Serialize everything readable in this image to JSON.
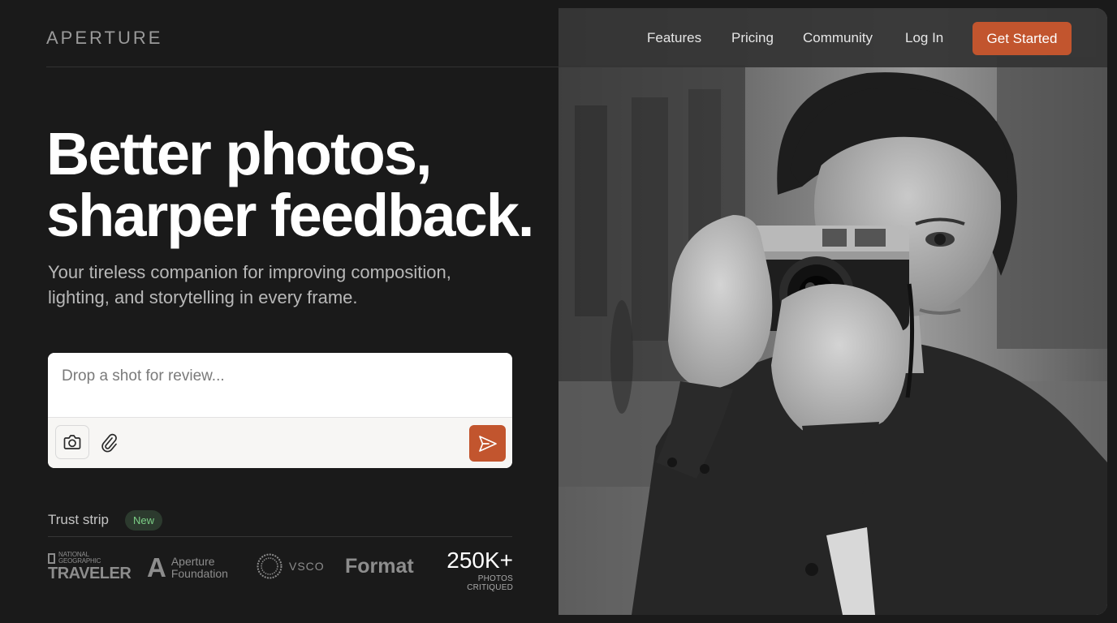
{
  "brand": {
    "name": "APERTURE"
  },
  "nav": {
    "links": [
      "Features",
      "Pricing",
      "Community",
      "Log In"
    ],
    "cta": "Get Started"
  },
  "hero": {
    "headline_line1": "Better photos,",
    "headline_line2": "sharper feedback.",
    "subtitle": "Your tireless companion for improving composition, lighting, and storytelling in every frame."
  },
  "composer": {
    "placeholder": "Drop a shot for review...",
    "icons": {
      "camera": "camera-icon",
      "attach": "paperclip-icon",
      "send": "send-icon"
    }
  },
  "trust": {
    "label": "Trust strip",
    "badge": "New",
    "logos": {
      "natgeo_small": "NATIONAL\nGEOGRAPHIC",
      "natgeo_big": "TRAVELER",
      "aperture_mark": "A",
      "aperture_text": "Aperture\nFoundation",
      "vsco": "VSCO",
      "format": "Format"
    },
    "stat": {
      "value": "250K+",
      "label": "PHOTOS CRITIQUED"
    }
  },
  "colors": {
    "background": "#1a1a1a",
    "accent": "#c2552e",
    "badge_bg": "#2c3a2e",
    "badge_text": "#7ccf86"
  }
}
